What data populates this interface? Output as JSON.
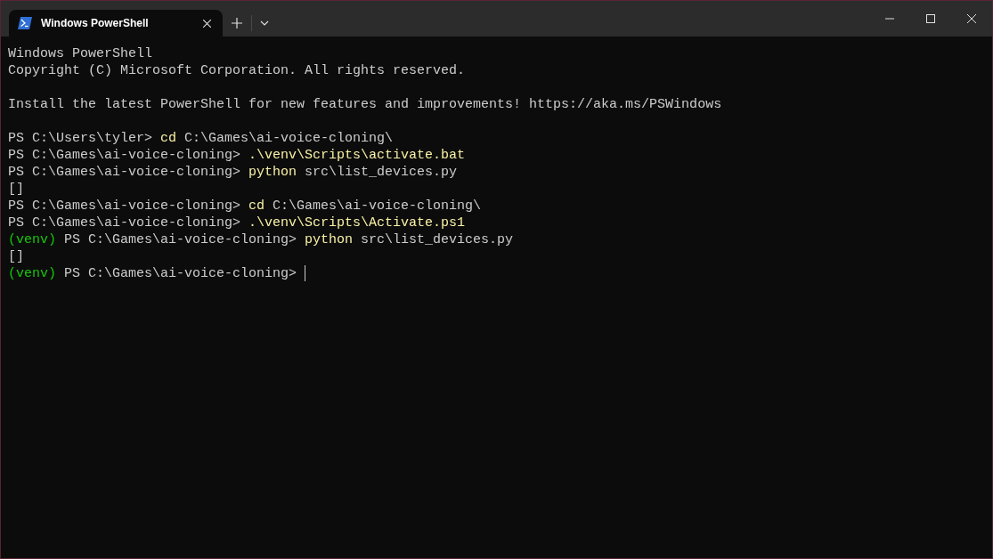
{
  "tabs": [
    {
      "label": "Windows PowerShell",
      "selected": true
    }
  ],
  "terminal": {
    "lines": [
      {
        "kind": "text",
        "segments": [
          {
            "text": "Windows PowerShell",
            "kind": "output"
          }
        ]
      },
      {
        "kind": "text",
        "segments": [
          {
            "text": "Copyright (C) Microsoft Corporation. All rights reserved.",
            "kind": "output"
          }
        ]
      },
      {
        "kind": "blank"
      },
      {
        "kind": "text",
        "segments": [
          {
            "text": "Install the latest PowerShell for new features and improvements! https://aka.ms/PSWindows",
            "kind": "output"
          }
        ]
      },
      {
        "kind": "blank"
      },
      {
        "kind": "text",
        "segments": [
          {
            "text": "PS C:\\Users\\tyler>",
            "kind": "prompt"
          },
          {
            "text": "cd",
            "kind": "command"
          },
          {
            "text": "C:\\Games\\ai-voice-cloning\\",
            "kind": "argument"
          }
        ]
      },
      {
        "kind": "text",
        "segments": [
          {
            "text": "PS C:\\Games\\ai-voice-cloning>",
            "kind": "prompt"
          },
          {
            "text": ".\\venv\\Scripts\\activate.bat",
            "kind": "command"
          }
        ]
      },
      {
        "kind": "text",
        "segments": [
          {
            "text": "PS C:\\Games\\ai-voice-cloning>",
            "kind": "prompt"
          },
          {
            "text": "python",
            "kind": "command"
          },
          {
            "text": "src\\list_devices.py",
            "kind": "argument"
          }
        ]
      },
      {
        "kind": "text",
        "segments": [
          {
            "text": "[]",
            "kind": "output"
          }
        ]
      },
      {
        "kind": "text",
        "segments": [
          {
            "text": "PS C:\\Games\\ai-voice-cloning>",
            "kind": "prompt"
          },
          {
            "text": "cd",
            "kind": "command"
          },
          {
            "text": "C:\\Games\\ai-voice-cloning\\",
            "kind": "argument"
          }
        ]
      },
      {
        "kind": "text",
        "segments": [
          {
            "text": "PS C:\\Games\\ai-voice-cloning>",
            "kind": "prompt"
          },
          {
            "text": ".\\venv\\Scripts\\Activate.ps1",
            "kind": "command"
          }
        ]
      },
      {
        "kind": "text",
        "segments": [
          {
            "text": "(venv)",
            "kind": "venv"
          },
          {
            "text": "PS C:\\Games\\ai-voice-cloning>",
            "kind": "prompt"
          },
          {
            "text": "python",
            "kind": "command"
          },
          {
            "text": "src\\list_devices.py",
            "kind": "argument"
          }
        ]
      },
      {
        "kind": "text",
        "segments": [
          {
            "text": "[]",
            "kind": "output"
          }
        ]
      },
      {
        "kind": "prompt",
        "segments": [
          {
            "text": "(venv)",
            "kind": "venv"
          },
          {
            "text": "PS C:\\Games\\ai-voice-cloning>",
            "kind": "prompt"
          }
        ]
      }
    ]
  }
}
